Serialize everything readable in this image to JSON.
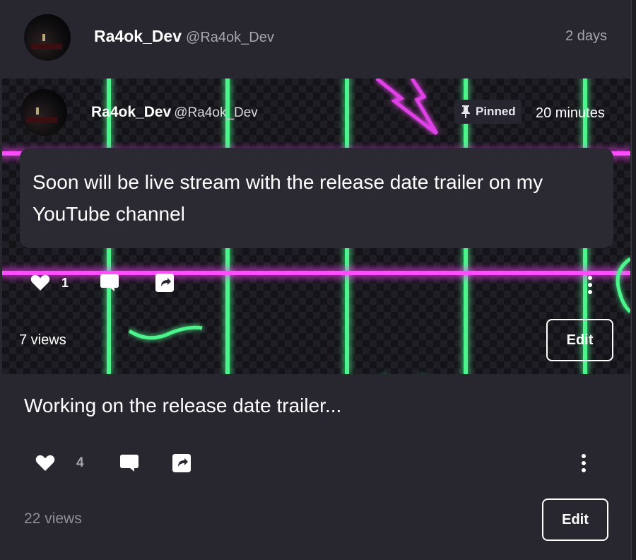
{
  "post": {
    "username": "Ra4ok_Dev",
    "handle": "@Ra4ok_Dev",
    "time": "2 days",
    "caption": "Working on the release date trailer...",
    "likes": "4",
    "views": "22 views",
    "edit_label": "Edit"
  },
  "embedded_post": {
    "username": "Ra4ok_Dev",
    "handle": "@Ra4ok_Dev",
    "pinned_label": "Pinned",
    "time": "20 minutes",
    "text": "Soon will be live stream with the release date trailer on my YouTube channel",
    "likes": "1",
    "views": "7 views",
    "edit_label": "Edit"
  },
  "icons": {
    "like": "heart-icon",
    "comment": "comment-icon",
    "share": "share-icon",
    "more": "more-vertical-icon",
    "pin": "pin-icon"
  },
  "colors": {
    "background": "#28262f",
    "neon_green": "#4bf58b",
    "neon_pink": "#ff4dff",
    "muted_text": "#a7a5ae"
  }
}
